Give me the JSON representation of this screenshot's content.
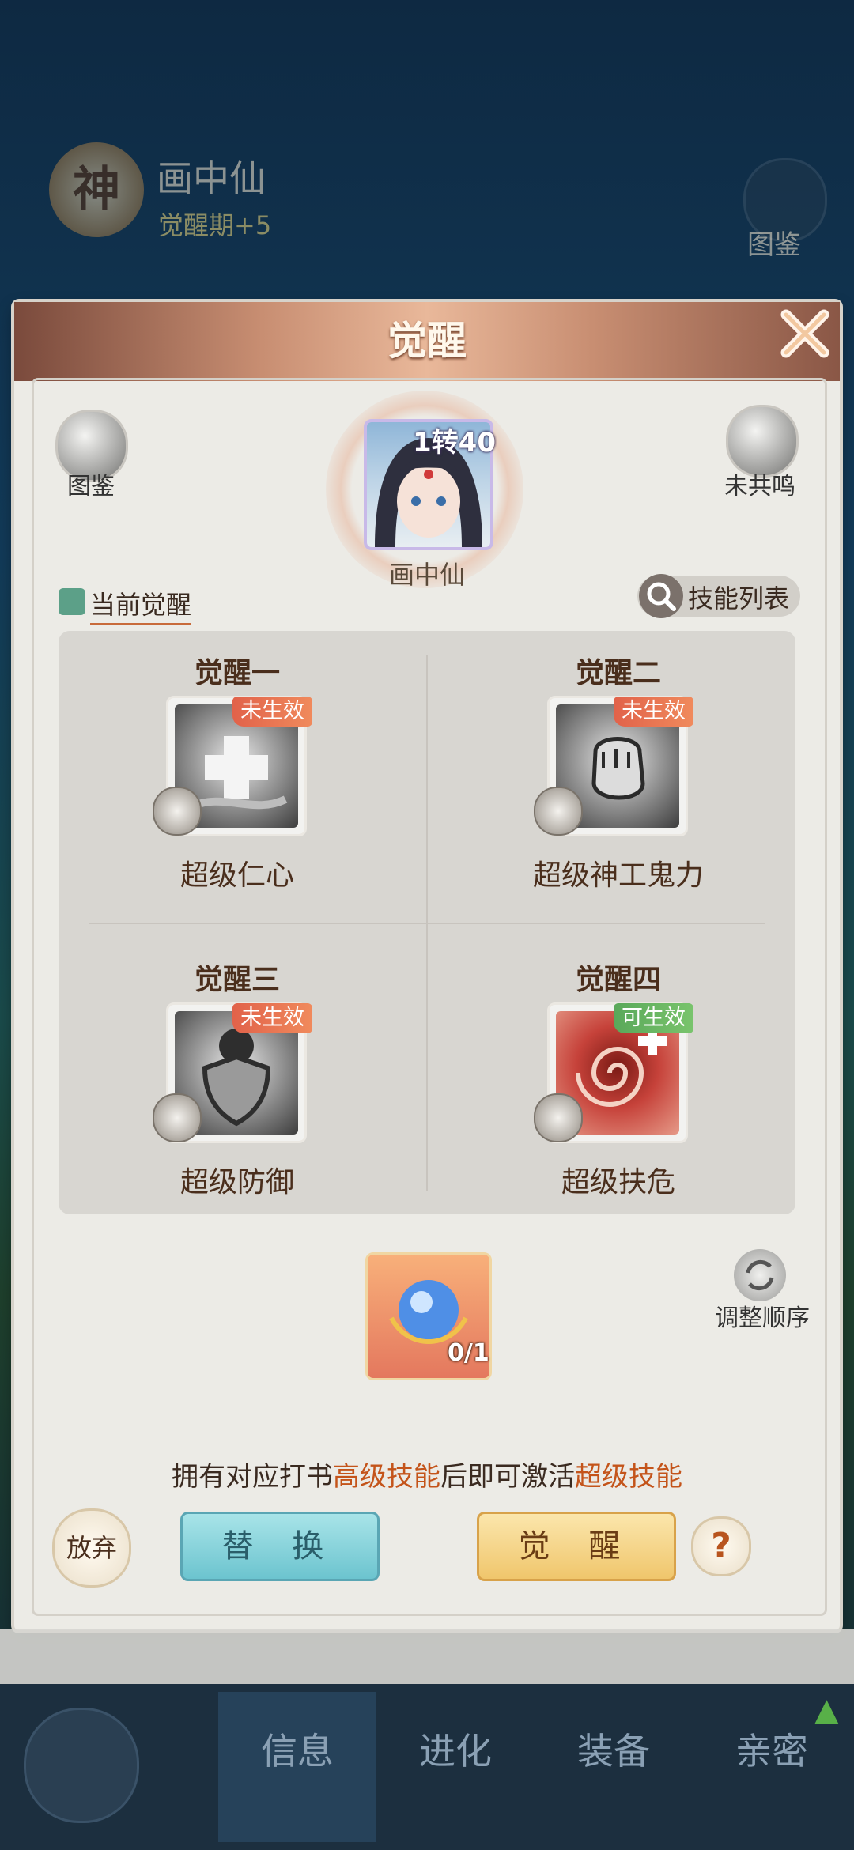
{
  "background": {
    "god_badge": "神",
    "character_name": "画中仙",
    "awaken_period": "觉醒期+5",
    "codex_label": "图鉴"
  },
  "dialog": {
    "title": "觉醒",
    "codex_label": "图鉴",
    "resonance_label": "未共鸣",
    "portrait": {
      "rank": "1转40",
      "name": "画中仙"
    },
    "current_awaken_label": "当前觉醒",
    "skill_list_label": "技能列表",
    "slots": [
      {
        "title": "觉醒一",
        "status": "未生效",
        "skill": "超级仁心",
        "icon": "medical-cross-icon"
      },
      {
        "title": "觉醒二",
        "status": "未生效",
        "skill": "超级神工鬼力",
        "icon": "fist-icon"
      },
      {
        "title": "觉醒三",
        "status": "未生效",
        "skill": "超级防御",
        "icon": "shield-icon"
      },
      {
        "title": "觉醒四",
        "status": "可生效",
        "skill": "超级扶危",
        "icon": "red-vortex-icon"
      }
    ],
    "item": {
      "count": "0/1",
      "icon": "blue-orb-icon"
    },
    "reorder_label": "调整顺序",
    "hint": {
      "part1": "拥有对应打书",
      "highlight1": "高级技能",
      "part2": "后即可激活",
      "highlight2": "超级技能"
    },
    "buttons": {
      "abandon": "放弃",
      "replace": "替 换",
      "awaken": "觉 醒",
      "help": "?"
    }
  },
  "nav": {
    "tabs": [
      "信息",
      "进化",
      "装备",
      "亲密"
    ]
  },
  "colors": {
    "highlight": "#c4541a",
    "status_inactive": "#e1624a",
    "status_active": "#5aa85a"
  }
}
